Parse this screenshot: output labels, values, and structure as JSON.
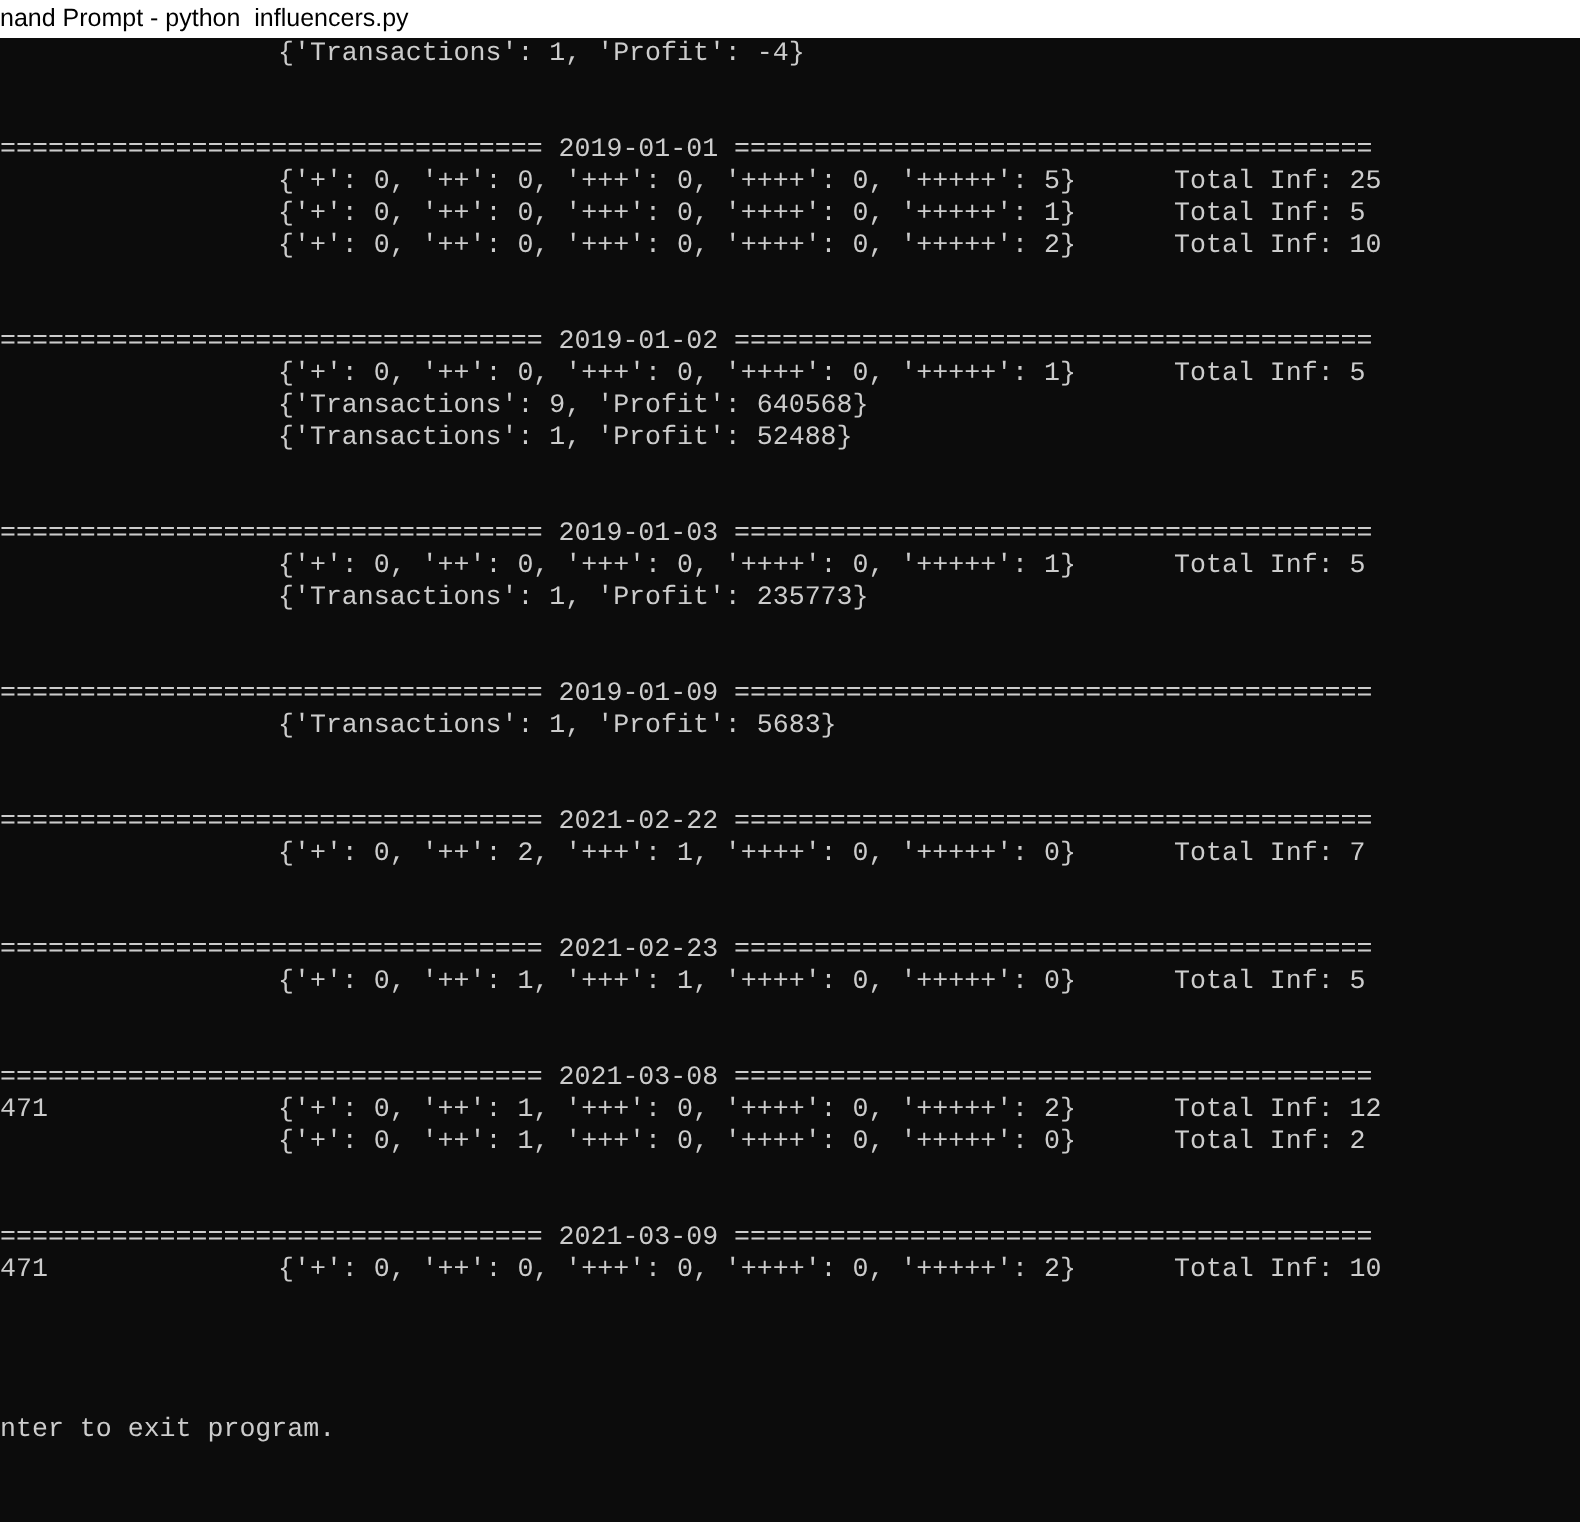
{
  "window": {
    "title": "nand Prompt - python  influencers.py"
  },
  "console": {
    "first_line": "{'Transactions': 1, 'Profit': -4}",
    "sections": [
      {
        "separator": "================================== 2019-01-01 ========================================",
        "rows": [
          {
            "dict": "{'+': 0, '++': 0, '+++': 0, '++++': 0, '+++++': 5}",
            "total": "Total Inf: 25"
          },
          {
            "dict": "{'+': 0, '++': 0, '+++': 0, '++++': 0, '+++++': 1}",
            "total": "Total Inf: 5"
          },
          {
            "dict": "{'+': 0, '++': 0, '+++': 0, '++++': 0, '+++++': 2}",
            "total": "Total Inf: 10"
          }
        ]
      },
      {
        "separator": "================================== 2019-01-02 ========================================",
        "rows": [
          {
            "dict": "{'+': 0, '++': 0, '+++': 0, '++++': 0, '+++++': 1}",
            "total": "Total Inf: 5"
          },
          {
            "dict": "{'Transactions': 9, 'Profit': 640568}"
          },
          {
            "dict": "{'Transactions': 1, 'Profit': 52488}"
          }
        ]
      },
      {
        "separator": "================================== 2019-01-03 ========================================",
        "rows": [
          {
            "dict": "{'+': 0, '++': 0, '+++': 0, '++++': 0, '+++++': 1}",
            "total": "Total Inf: 5"
          },
          {
            "dict": "{'Transactions': 1, 'Profit': 235773}"
          }
        ]
      },
      {
        "separator": "================================== 2019-01-09 ========================================",
        "rows": [
          {
            "dict": "{'Transactions': 1, 'Profit': 5683}"
          }
        ]
      },
      {
        "separator": "================================== 2021-02-22 ========================================",
        "rows": [
          {
            "dict": "{'+': 0, '++': 2, '+++': 1, '++++': 0, '+++++': 0}",
            "total": "Total Inf: 7"
          }
        ]
      },
      {
        "separator": "================================== 2021-02-23 ========================================",
        "rows": [
          {
            "dict": "{'+': 0, '++': 1, '+++': 1, '++++': 0, '+++++': 0}",
            "total": "Total Inf: 5"
          }
        ]
      },
      {
        "separator": "================================== 2021-03-08 ========================================",
        "rows": [
          {
            "prefix": "471",
            "dict": "{'+': 0, '++': 1, '+++': 0, '++++': 0, '+++++': 2}",
            "total": "Total Inf: 12"
          },
          {
            "dict": "{'+': 0, '++': 1, '+++': 0, '++++': 0, '+++++': 0}",
            "total": "Total Inf: 2"
          }
        ]
      },
      {
        "separator": "================================== 2021-03-09 ========================================",
        "rows": [
          {
            "prefix": "471",
            "dict": "{'+': 0, '++': 0, '+++': 0, '++++': 0, '+++++': 2}",
            "total": "Total Inf: 10"
          }
        ]
      }
    ],
    "prompt": "nter to exit program."
  }
}
